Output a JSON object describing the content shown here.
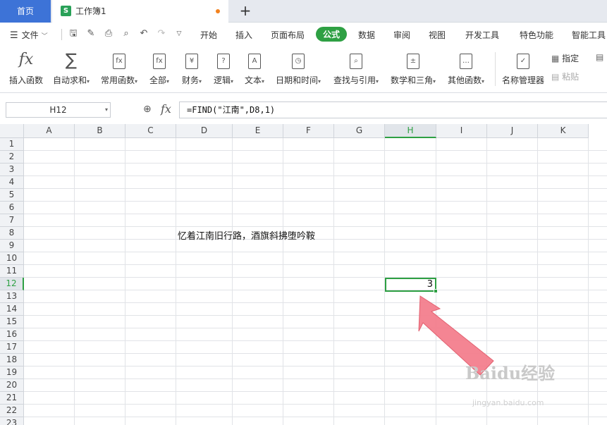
{
  "titlebar": {
    "home_tab": "首页",
    "doc_tab": "工作簿1",
    "doc_logo": "S",
    "new_tab": "+"
  },
  "menu": {
    "file": "文件",
    "tabs": [
      {
        "label": "开始"
      },
      {
        "label": "插入"
      },
      {
        "label": "页面布局"
      },
      {
        "label": "公式",
        "active": true
      },
      {
        "label": "数据"
      },
      {
        "label": "审阅"
      },
      {
        "label": "视图"
      },
      {
        "label": "开发工具"
      },
      {
        "label": "特色功能"
      },
      {
        "label": "智能工具"
      }
    ]
  },
  "ribbon": {
    "buttons": [
      {
        "label": "插入函数",
        "icon": "fx-icon"
      },
      {
        "label": "自动求和",
        "icon": "sigma-icon"
      },
      {
        "label": "常用函数",
        "icon": "common-functions-icon"
      },
      {
        "label": "全部",
        "icon": "all-functions-icon"
      },
      {
        "label": "财务",
        "icon": "finance-icon"
      },
      {
        "label": "逻辑",
        "icon": "logic-icon"
      },
      {
        "label": "文本",
        "icon": "text-icon"
      },
      {
        "label": "日期和时间",
        "icon": "clock-icon"
      },
      {
        "label": "查找与引用",
        "icon": "lookup-icon"
      },
      {
        "label": "数学和三角",
        "icon": "math-icon"
      },
      {
        "label": "其他函数",
        "icon": "other-functions-icon"
      },
      {
        "label": "名称管理器",
        "icon": "name-manager-icon"
      }
    ],
    "side": {
      "assign": "指定",
      "paste": "粘贴"
    }
  },
  "formula_bar": {
    "name_box": "H12",
    "fx": "fx",
    "formula": "=FIND(\"江南\",D8,1)"
  },
  "sheet": {
    "columns": [
      "A",
      "B",
      "C",
      "D",
      "E",
      "F",
      "G",
      "H",
      "I",
      "J",
      "K"
    ],
    "rows": [
      "1",
      "2",
      "3",
      "4",
      "5",
      "6",
      "7",
      "8",
      "9",
      "10",
      "11",
      "12",
      "13",
      "14",
      "15",
      "16",
      "17",
      "18",
      "19",
      "20",
      "21",
      "22",
      "23"
    ],
    "selected_column": "H",
    "selected_row": "12",
    "d8_text": "忆着江南旧行路，酒旗斜拂堕吟鞍",
    "h12_value": "3"
  },
  "watermark": {
    "brand": "Baidu经验",
    "url": "jingyan.baidu.com"
  },
  "colors": {
    "accent_green": "#2ea043",
    "home_blue": "#3d73d7",
    "arrow_pink": "#f47b8a"
  }
}
